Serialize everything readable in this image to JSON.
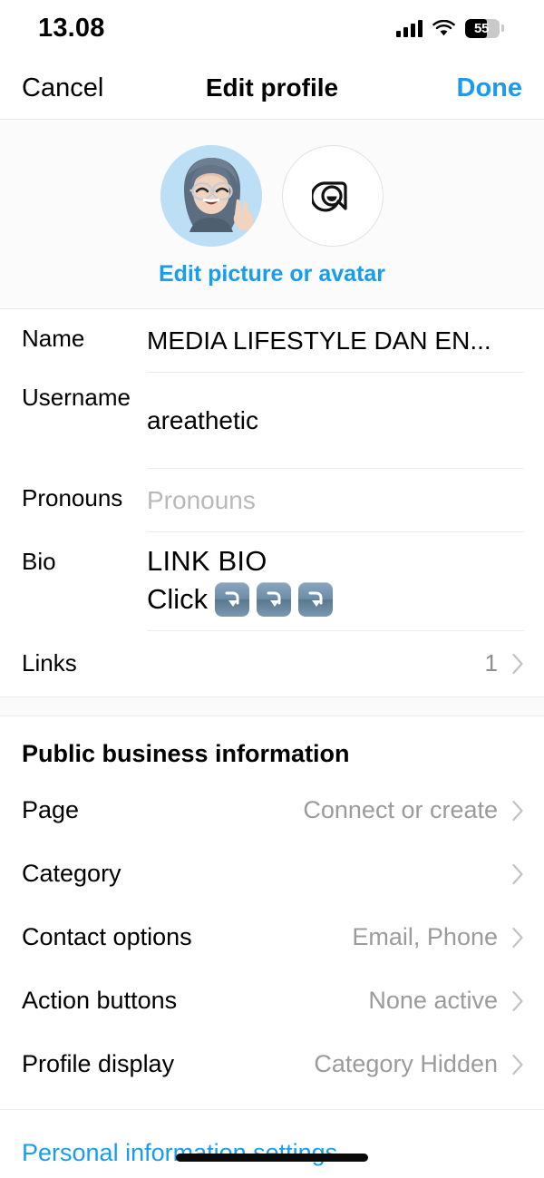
{
  "status_bar": {
    "time": "13.08",
    "signal_icon": "cellular-signal-icon",
    "wifi_icon": "wifi-icon",
    "battery_percent": "55",
    "battery_icon": "battery-icon"
  },
  "nav": {
    "cancel_label": "Cancel",
    "title": "Edit profile",
    "done_label": "Done",
    "done_color": "#1a9af0"
  },
  "profile": {
    "picture_name": "profile-picture",
    "avatar_icon": "instagram-avatar-icon",
    "edit_link": "Edit picture or avatar",
    "link_color": "#189ced"
  },
  "fields": [
    {
      "label": "Name",
      "value": "MEDIA LIFESTYLE DAN EN...",
      "is_placeholder": false
    },
    {
      "label": "Username",
      "value": "areathetic",
      "is_placeholder": false
    },
    {
      "label": "Pronouns",
      "value": "Pronouns",
      "is_placeholder": true
    }
  ],
  "bio": {
    "label": "Bio",
    "line1": "LINK BIO",
    "line2_text": "Click",
    "emoji_count": 3,
    "emoji_name": "arrow-curving-down-emoji"
  },
  "links": {
    "label": "Links",
    "value": "1",
    "chevron_icon": "chevron-right-icon"
  },
  "business": {
    "title": "Public business information",
    "rows": [
      {
        "label": "Page",
        "value": "Connect or create"
      },
      {
        "label": "Category",
        "value": ""
      },
      {
        "label": "Contact options",
        "value": "Email, Phone"
      },
      {
        "label": "Action buttons",
        "value": "None active"
      },
      {
        "label": "Profile display",
        "value": "Category Hidden"
      }
    ]
  },
  "footer": {
    "link_label": "Personal information settings"
  }
}
